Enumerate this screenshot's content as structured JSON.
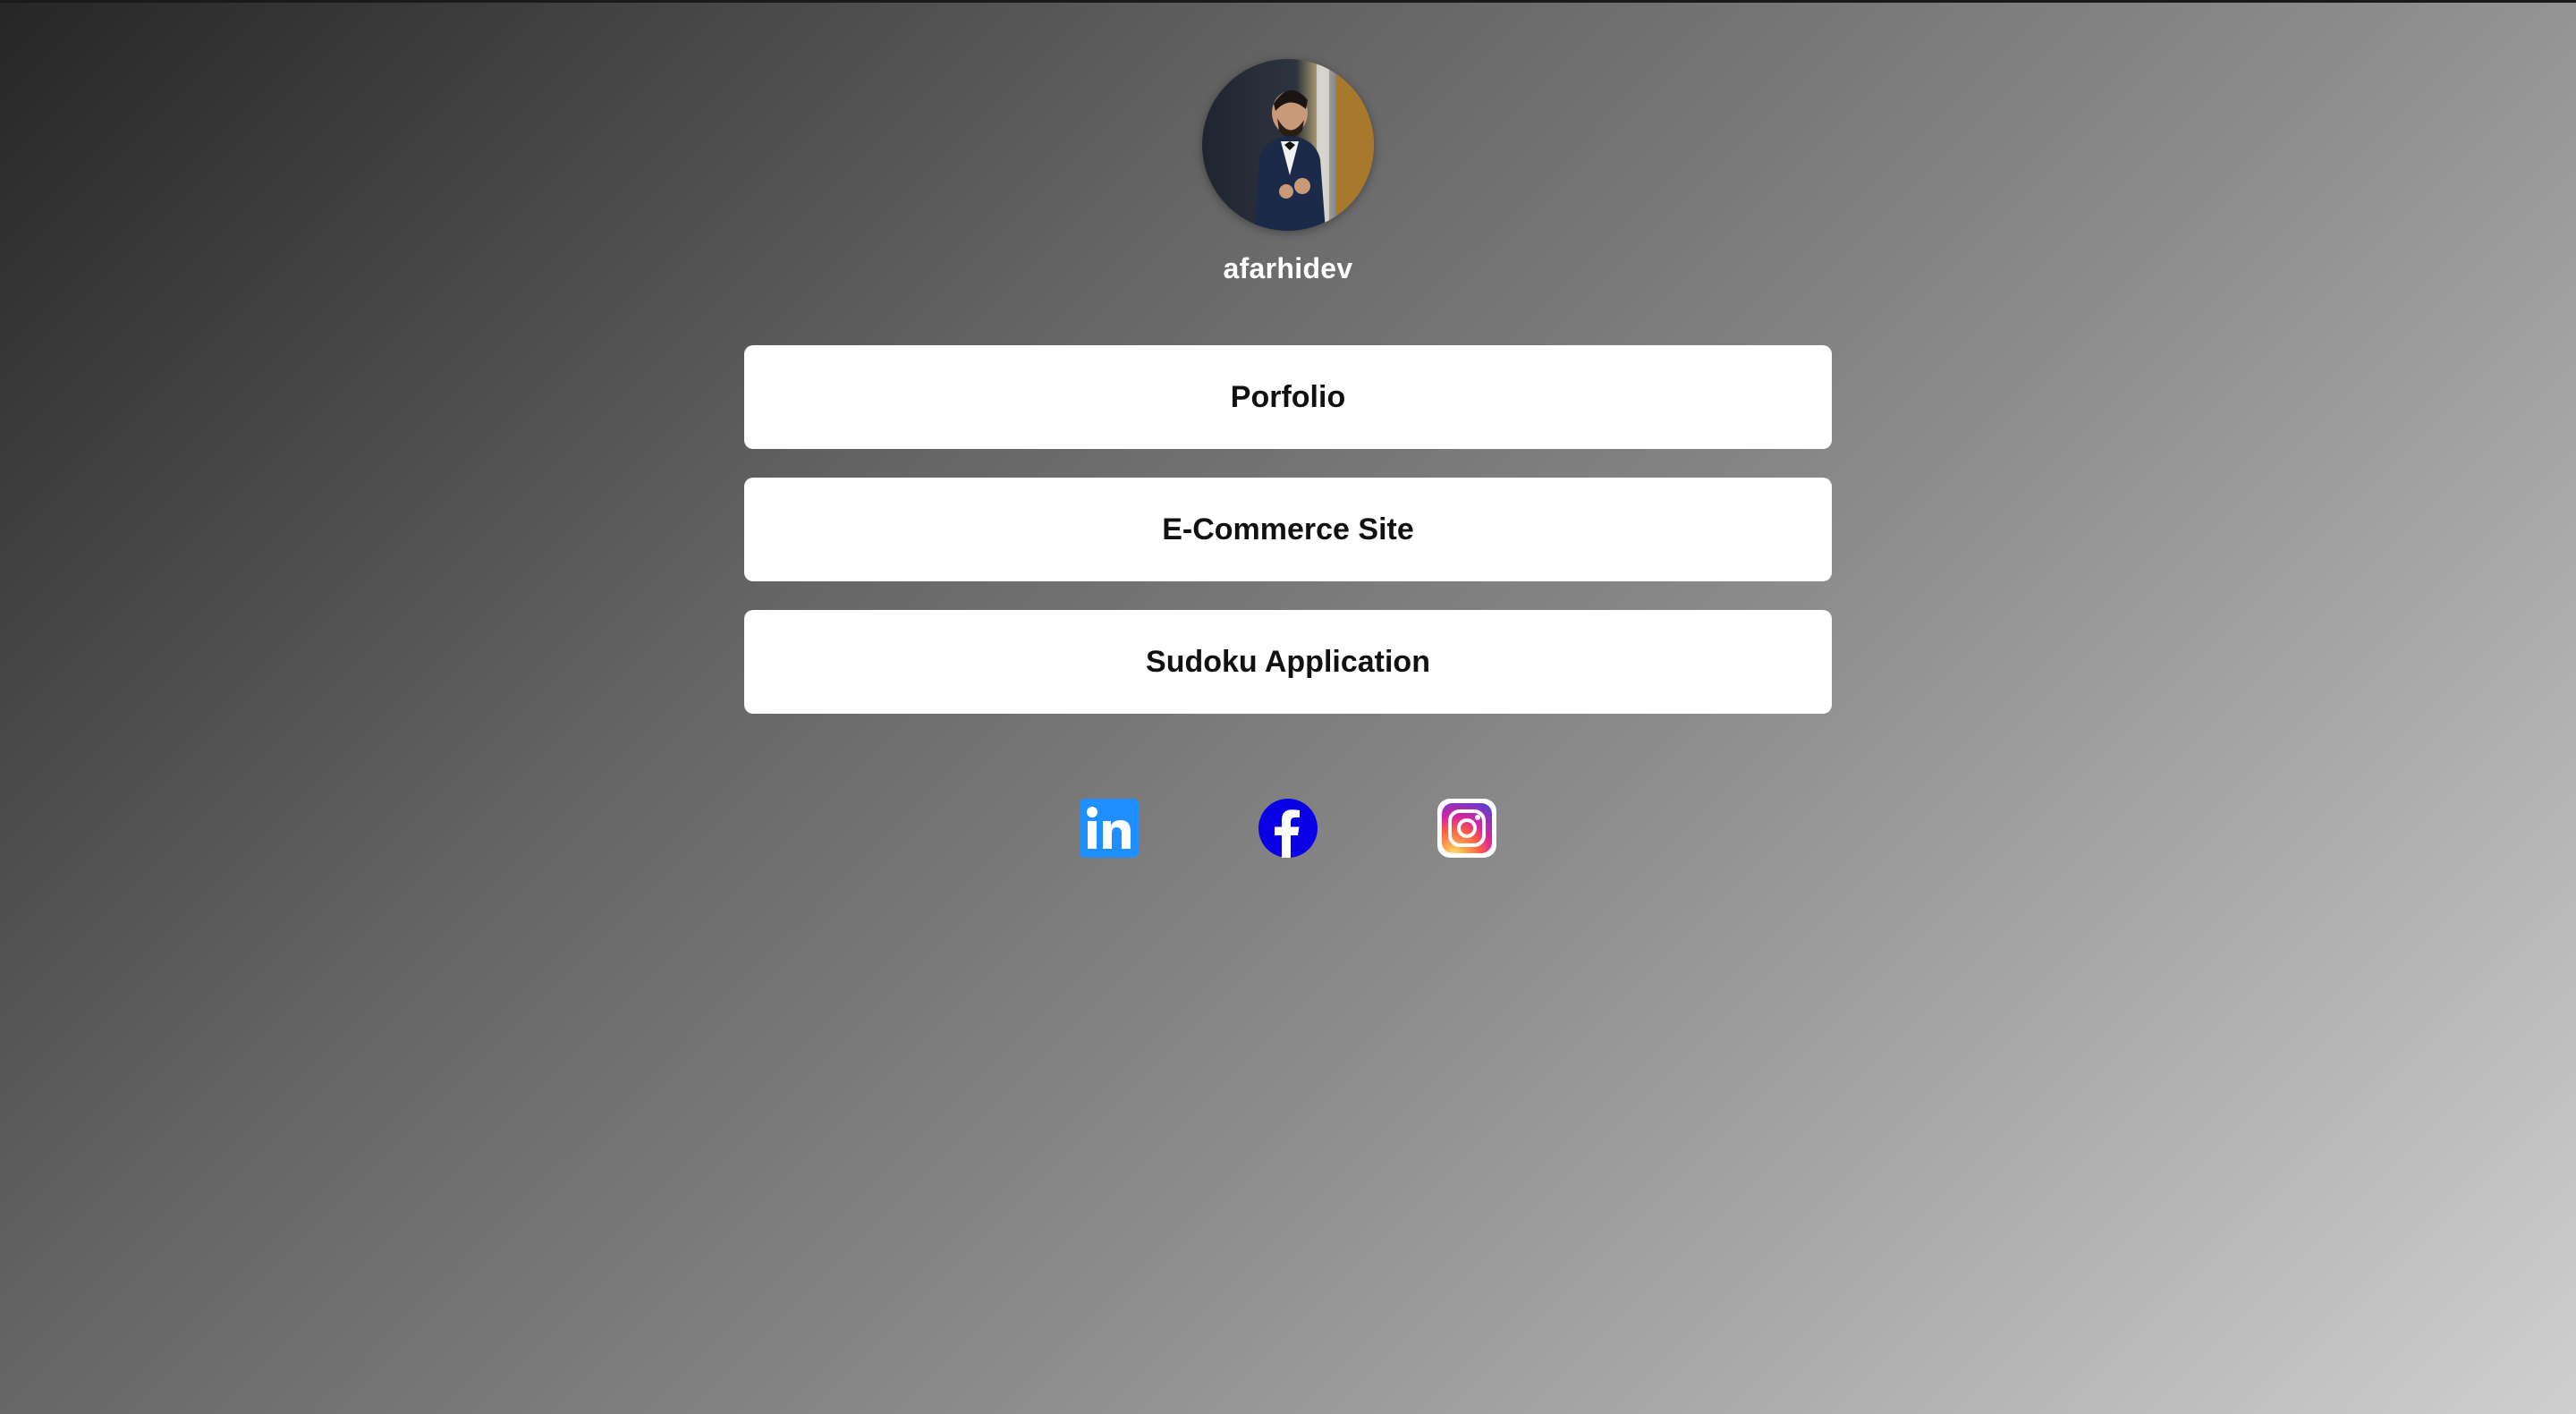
{
  "profile": {
    "username": "afarhidev",
    "avatar_alt": "profile photo"
  },
  "links": [
    {
      "label": "Porfolio"
    },
    {
      "label": "E-Commerce Site"
    },
    {
      "label": "Sudoku Application"
    }
  ],
  "social": [
    {
      "icon": "linkedin-icon",
      "color": "#1f8fff"
    },
    {
      "icon": "facebook-icon",
      "color": "#0a00e6"
    },
    {
      "icon": "instagram-icon",
      "color": "#d6249f"
    }
  ],
  "colors": {
    "button_bg": "#ffffff",
    "button_text": "#111111",
    "username_text": "#ffffff"
  }
}
